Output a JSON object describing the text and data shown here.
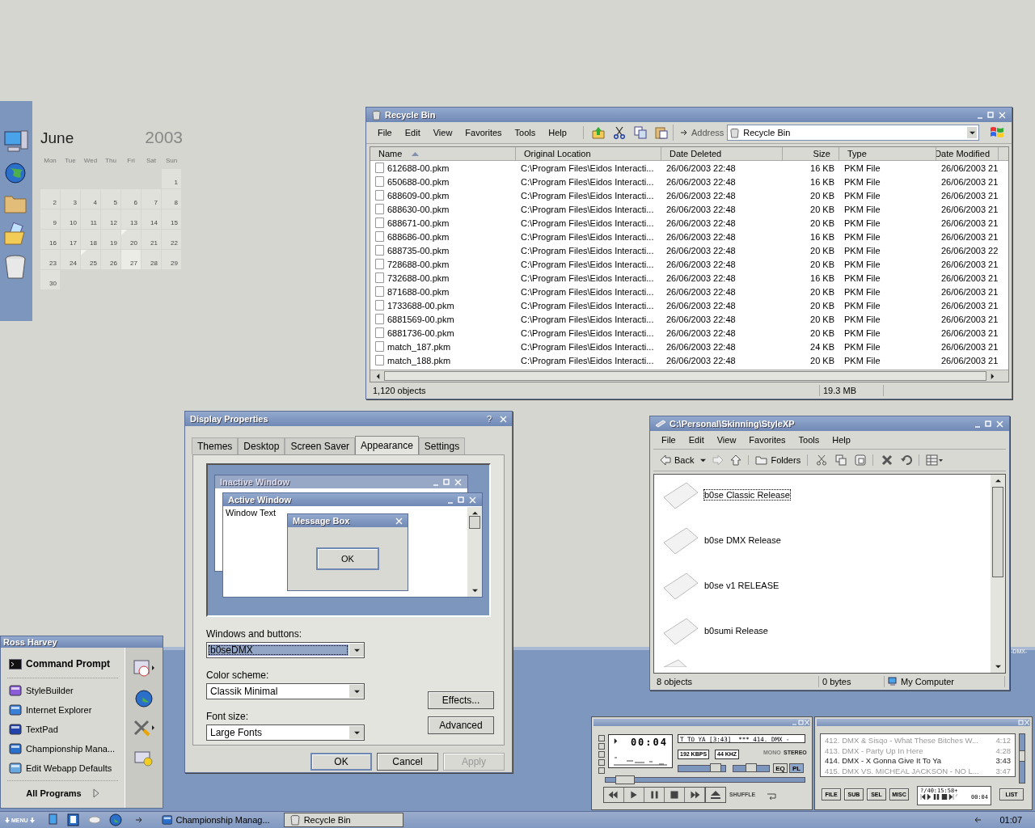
{
  "calendar": {
    "month": "June",
    "year": "2003",
    "weekdays": [
      "Mon",
      "Tue",
      "Wed",
      "Thu",
      "Fri",
      "Sat",
      "Sun"
    ],
    "weeks": [
      [
        {
          "day": "1",
          "today": false,
          "marked": false
        }
      ],
      [
        {
          "day": "2",
          "today": false,
          "marked": false
        },
        {
          "day": "3",
          "today": false,
          "marked": false
        },
        {
          "day": "4",
          "today": false,
          "marked": false
        },
        {
          "day": "5",
          "today": false,
          "marked": false
        },
        {
          "day": "6",
          "today": false,
          "marked": false
        },
        {
          "day": "7",
          "today": false,
          "marked": false
        },
        {
          "day": "8",
          "today": false,
          "marked": false
        }
      ],
      [
        {
          "day": "9",
          "today": false,
          "marked": false
        },
        {
          "day": "10",
          "today": false,
          "marked": false
        },
        {
          "day": "11",
          "today": false,
          "marked": false
        },
        {
          "day": "12",
          "today": false,
          "marked": false
        },
        {
          "day": "13",
          "today": false,
          "marked": false
        },
        {
          "day": "14",
          "today": false,
          "marked": false
        },
        {
          "day": "15",
          "today": false,
          "marked": false
        }
      ],
      [
        {
          "day": "16",
          "today": false,
          "marked": false
        },
        {
          "day": "17",
          "today": false,
          "marked": false
        },
        {
          "day": "18",
          "today": false,
          "marked": false
        },
        {
          "day": "19",
          "today": false,
          "marked": false
        },
        {
          "day": "20",
          "today": false,
          "marked": true
        },
        {
          "day": "21",
          "today": false,
          "marked": false
        },
        {
          "day": "22",
          "today": false,
          "marked": false
        }
      ],
      [
        {
          "day": "23",
          "today": false,
          "marked": false
        },
        {
          "day": "24",
          "today": false,
          "marked": false
        },
        {
          "day": "25",
          "today": false,
          "marked": true
        },
        {
          "day": "26",
          "today": false,
          "marked": false
        },
        {
          "day": "27",
          "today": true,
          "marked": false
        },
        {
          "day": "28",
          "today": false,
          "marked": false
        },
        {
          "day": "29",
          "today": false,
          "marked": false
        }
      ],
      [
        {
          "day": "30",
          "today": false,
          "marked": false
        }
      ]
    ]
  },
  "recycle_bin": {
    "title": "Recycle Bin",
    "menu": [
      "File",
      "Edit",
      "View",
      "Favorites",
      "Tools",
      "Help"
    ],
    "address_label": "Address",
    "address": "Recycle Bin",
    "columns": [
      {
        "label": "Name",
        "sorted": true
      },
      {
        "label": "Original Location",
        "sorted": false
      },
      {
        "label": "Date Deleted",
        "sorted": false
      },
      {
        "label": "Size",
        "sorted": false
      },
      {
        "label": "Type",
        "sorted": false
      },
      {
        "label": "Date Modified",
        "sorted": false
      }
    ],
    "rows": [
      {
        "name": "612688-00.pkm",
        "location": "C:\\Program Files\\Eidos Interacti...",
        "deleted": "26/06/2003 22:48",
        "size": "16 KB",
        "type": "PKM File",
        "modified": "26/06/2003 21"
      },
      {
        "name": "650688-00.pkm",
        "location": "C:\\Program Files\\Eidos Interacti...",
        "deleted": "26/06/2003 22:48",
        "size": "16 KB",
        "type": "PKM File",
        "modified": "26/06/2003 21"
      },
      {
        "name": "688609-00.pkm",
        "location": "C:\\Program Files\\Eidos Interacti...",
        "deleted": "26/06/2003 22:48",
        "size": "20 KB",
        "type": "PKM File",
        "modified": "26/06/2003 21"
      },
      {
        "name": "688630-00.pkm",
        "location": "C:\\Program Files\\Eidos Interacti...",
        "deleted": "26/06/2003 22:48",
        "size": "20 KB",
        "type": "PKM File",
        "modified": "26/06/2003 21"
      },
      {
        "name": "688671-00.pkm",
        "location": "C:\\Program Files\\Eidos Interacti...",
        "deleted": "26/06/2003 22:48",
        "size": "20 KB",
        "type": "PKM File",
        "modified": "26/06/2003 21"
      },
      {
        "name": "688686-00.pkm",
        "location": "C:\\Program Files\\Eidos Interacti...",
        "deleted": "26/06/2003 22:48",
        "size": "16 KB",
        "type": "PKM File",
        "modified": "26/06/2003 21"
      },
      {
        "name": "688735-00.pkm",
        "location": "C:\\Program Files\\Eidos Interacti...",
        "deleted": "26/06/2003 22:48",
        "size": "20 KB",
        "type": "PKM File",
        "modified": "26/06/2003 22"
      },
      {
        "name": "728688-00.pkm",
        "location": "C:\\Program Files\\Eidos Interacti...",
        "deleted": "26/06/2003 22:48",
        "size": "20 KB",
        "type": "PKM File",
        "modified": "26/06/2003 21"
      },
      {
        "name": "732688-00.pkm",
        "location": "C:\\Program Files\\Eidos Interacti...",
        "deleted": "26/06/2003 22:48",
        "size": "16 KB",
        "type": "PKM File",
        "modified": "26/06/2003 21"
      },
      {
        "name": "871688-00.pkm",
        "location": "C:\\Program Files\\Eidos Interacti...",
        "deleted": "26/06/2003 22:48",
        "size": "20 KB",
        "type": "PKM File",
        "modified": "26/06/2003 21"
      },
      {
        "name": "1733688-00.pkm",
        "location": "C:\\Program Files\\Eidos Interacti...",
        "deleted": "26/06/2003 22:48",
        "size": "20 KB",
        "type": "PKM File",
        "modified": "26/06/2003 21"
      },
      {
        "name": "6881569-00.pkm",
        "location": "C:\\Program Files\\Eidos Interacti...",
        "deleted": "26/06/2003 22:48",
        "size": "20 KB",
        "type": "PKM File",
        "modified": "26/06/2003 21"
      },
      {
        "name": "6881736-00.pkm",
        "location": "C:\\Program Files\\Eidos Interacti...",
        "deleted": "26/06/2003 22:48",
        "size": "20 KB",
        "type": "PKM File",
        "modified": "26/06/2003 21"
      },
      {
        "name": "match_187.pkm",
        "location": "C:\\Program Files\\Eidos Interacti...",
        "deleted": "26/06/2003 22:48",
        "size": "24 KB",
        "type": "PKM File",
        "modified": "26/06/2003 21"
      },
      {
        "name": "match_188.pkm",
        "location": "C:\\Program Files\\Eidos Interacti...",
        "deleted": "26/06/2003 22:48",
        "size": "20 KB",
        "type": "PKM File",
        "modified": "26/06/2003 21"
      }
    ],
    "status": [
      "1,120 objects",
      "19.3 MB"
    ]
  },
  "display_properties": {
    "title": "Display Properties",
    "help": "?",
    "tabs": [
      {
        "label": "Themes",
        "selected": false
      },
      {
        "label": "Desktop",
        "selected": false
      },
      {
        "label": "Screen Saver",
        "selected": false
      },
      {
        "label": "Appearance",
        "selected": true
      },
      {
        "label": "Settings",
        "selected": false
      }
    ],
    "preview": {
      "inactive_title": "Inactive Window",
      "active_title": "Active Window",
      "window_text": "Window Text",
      "message_title": "Message Box",
      "ok": "OK"
    },
    "fields": [
      {
        "label": "Windows and buttons:",
        "value": "b0seDMX",
        "focused": true
      },
      {
        "label": "Color scheme:",
        "value": "Classik Minimal",
        "focused": false
      },
      {
        "label": "Font size:",
        "value": "Large Fonts",
        "focused": false
      }
    ],
    "side_buttons": [
      "Effects...",
      "Advanced"
    ],
    "buttons": [
      {
        "label": "OK",
        "default": true,
        "disabled": false
      },
      {
        "label": "Cancel",
        "default": false,
        "disabled": false
      },
      {
        "label": "Apply",
        "default": false,
        "disabled": true
      }
    ]
  },
  "stylexp": {
    "title": "C:\\Personal\\Skinning\\StyleXP",
    "menu": [
      "File",
      "Edit",
      "View",
      "Favorites",
      "Tools",
      "Help"
    ],
    "back": "Back",
    "folders": "Folders",
    "items": [
      {
        "name": "b0se Classic Release",
        "selected": true
      },
      {
        "name": "b0se DMX Release",
        "selected": false
      },
      {
        "name": "b0se v1 RELEASE",
        "selected": false
      },
      {
        "name": "b0sumi Release",
        "selected": false
      }
    ],
    "status": [
      "8 objects",
      "0 bytes",
      "My Computer"
    ]
  },
  "side_label": "-DMX-",
  "start_menu": {
    "user": "Ross Harvey",
    "pinned": [
      "Command Prompt"
    ],
    "recent": [
      "StyleBuilder",
      "Internet Explorer",
      "TextPad",
      "Championship Mana...",
      "Edit Webapp Defaults"
    ],
    "all_programs": "All Programs"
  },
  "winamp": {
    "time": "00:04",
    "ticker": "T TO YA [3:43]  *** 414. DMX -",
    "bitrate": "192 KBPS",
    "rate": "44 KHZ",
    "mono": {
      "label": "MONO",
      "on": false
    },
    "stereo": {
      "label": "STEREO",
      "on": true
    },
    "volume": {
      "level": 0.88
    },
    "balance": {
      "level": 0.5
    },
    "seek": {
      "level": 0.05
    },
    "eq": {
      "label": "EQ",
      "on": false
    },
    "pl": {
      "label": "PL",
      "on": true
    },
    "shuffle": "SHUFFLE"
  },
  "playlist": {
    "entries": [
      {
        "title": "412. DMX & Sisqo - What These Bitches W...",
        "time": "4:12",
        "current": false
      },
      {
        "title": "413. DMX - Party Up In Here",
        "time": "4:28",
        "current": false
      },
      {
        "title": "414. DMX - X Gonna Give It To Ya",
        "time": "3:43",
        "current": true
      },
      {
        "title": "415. DMX VS. MICHEAL JACKSON - NO L...",
        "time": "3:47",
        "current": false
      }
    ],
    "buttons": [
      "FILE",
      "SUB",
      "SEL",
      "MISC"
    ],
    "total": "?/40:15:58+",
    "time": "00:04",
    "list": "LIST"
  },
  "taskbar": {
    "menu": "MENU",
    "tasks": [
      {
        "label": "Championship Manag...",
        "selected": false
      },
      {
        "label": "Recycle Bin",
        "selected": true
      }
    ],
    "clock": "01:07"
  }
}
